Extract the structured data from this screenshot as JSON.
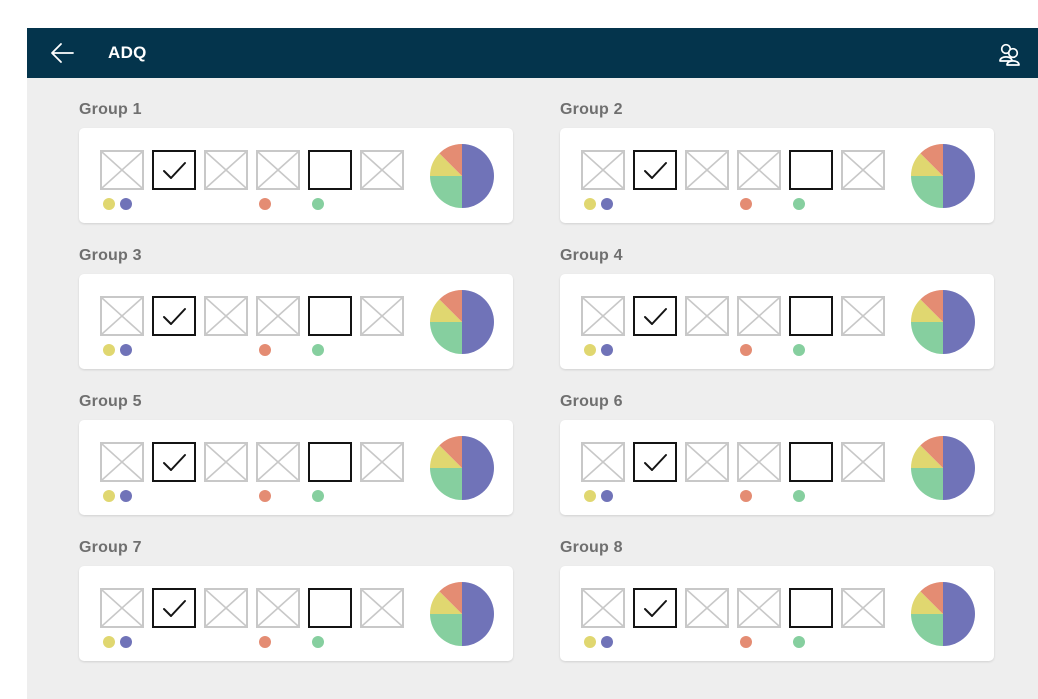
{
  "header": {
    "title": "ADQ",
    "back_icon": "arrow-left-icon",
    "users_icon": "users-icon"
  },
  "colors": {
    "header_bg": "#04344c",
    "canvas_bg": "#eeeeee",
    "yellow": "#e0d770",
    "purple": "#7073b8",
    "orange": "#e48c73",
    "green": "#86cf9f"
  },
  "groups": [
    {
      "label": "Group 1"
    },
    {
      "label": "Group 2"
    },
    {
      "label": "Group 3"
    },
    {
      "label": "Group 4"
    },
    {
      "label": "Group 5"
    },
    {
      "label": "Group 6"
    },
    {
      "label": "Group 7"
    },
    {
      "label": "Group 8"
    }
  ],
  "item_states": [
    "placeholder",
    "checked",
    "placeholder",
    "placeholder",
    "empty",
    "placeholder"
  ],
  "item_dots": [
    [
      "yellow",
      "purple"
    ],
    [],
    [],
    [
      "orange"
    ],
    [
      "green"
    ],
    []
  ],
  "chart_data": {
    "type": "pie",
    "slices": [
      {
        "color": "#7073b8",
        "value": 50
      },
      {
        "color": "#86cf9f",
        "value": 25
      },
      {
        "color": "#e0d770",
        "value": 12.5
      },
      {
        "color": "#e48c73",
        "value": 12.5
      }
    ]
  }
}
